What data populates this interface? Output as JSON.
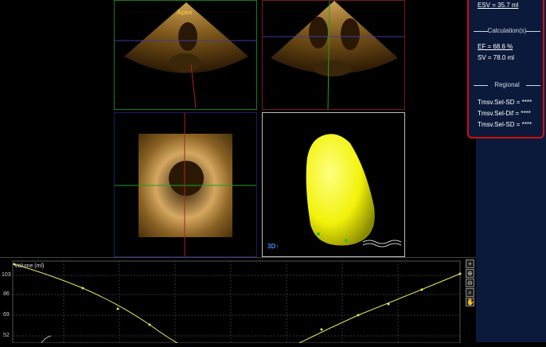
{
  "views": {
    "apex_label": "Apex",
    "badge_3d": "3D↑"
  },
  "results": {
    "esv": "ESV = 35.7 ml",
    "calculations_title": "Calculation(s)",
    "ef": "EF = 68.6 %",
    "sv": "SV = 78.0 ml",
    "regional_title": "Regional",
    "tmsv_sd_1": "Tmsv.Sel-SD = ****",
    "tmsv_dif": "Tmsv.Sel-Dif = ****",
    "tmsv_sd_2": "Tmsv.Sel-SD = ****"
  },
  "volume_graph": {
    "ylabel": "Volume (ml)",
    "yticks": [
      "103",
      "86",
      "69",
      "52"
    ]
  },
  "colors": {
    "accent_red": "#d01010",
    "curve": "#e8e860",
    "lv_model": "#f2f20a",
    "panel_bg": "#0b1a3a"
  }
}
